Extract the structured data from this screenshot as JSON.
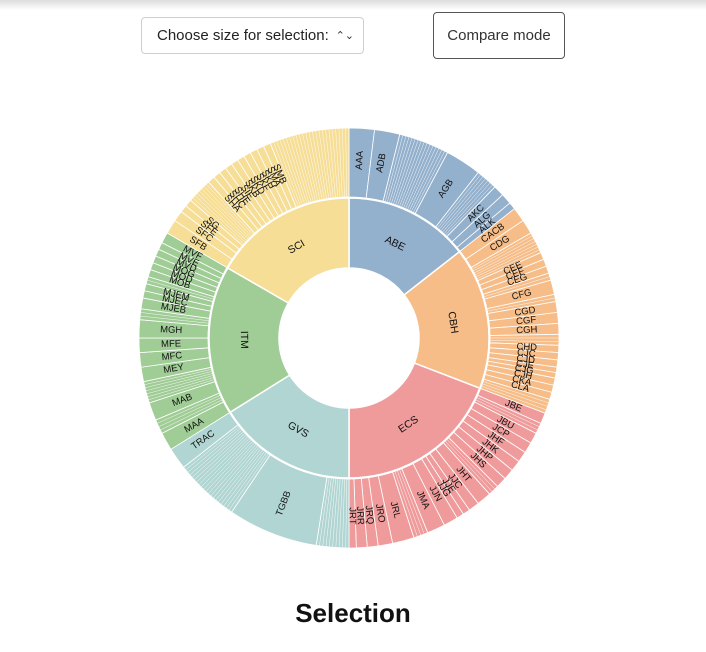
{
  "controls": {
    "size_select_label": "Choose size for selection:",
    "compare_label": "Compare mode"
  },
  "section_title": "Selection",
  "chart_data": {
    "type": "sunburst",
    "center_empty": true,
    "groups": [
      {
        "name": "ABE",
        "color": "#93b0cc",
        "start": 0,
        "end": 52,
        "children": [
          {
            "name": "AAA",
            "s": 0,
            "e": 7,
            "label": true
          },
          {
            "name": "ADB",
            "s": 7,
            "e": 14,
            "label": true
          },
          {
            "name": "",
            "s": 14,
            "e": 28,
            "label": false,
            "fine": true
          },
          {
            "name": "AGB",
            "s": 28,
            "e": 38,
            "label": true
          },
          {
            "name": "",
            "s": 38,
            "e": 44,
            "label": false,
            "fine": true
          },
          {
            "name": "AKC",
            "s": 44,
            "e": 47,
            "label": true
          },
          {
            "name": "ALG",
            "s": 47,
            "e": 50,
            "label": true
          },
          {
            "name": "ALK",
            "s": 50,
            "e": 52,
            "label": true
          }
        ]
      },
      {
        "name": "CBH",
        "color": "#f6bd88",
        "start": 52,
        "end": 111,
        "children": [
          {
            "name": "CACB",
            "s": 52,
            "e": 56,
            "label": true
          },
          {
            "name": "CDG",
            "s": 56,
            "e": 60,
            "label": true
          },
          {
            "name": "",
            "s": 60,
            "e": 66,
            "label": false,
            "fine": true
          },
          {
            "name": "CEE",
            "s": 66,
            "e": 68,
            "label": true
          },
          {
            "name": "CEF",
            "s": 68,
            "e": 70,
            "label": true
          },
          {
            "name": "CEG",
            "s": 70,
            "e": 72,
            "label": true
          },
          {
            "name": "",
            "s": 72,
            "e": 74,
            "label": false,
            "fine": true
          },
          {
            "name": "CFG",
            "s": 74,
            "e": 78,
            "label": true
          },
          {
            "name": "",
            "s": 78,
            "e": 80,
            "label": false,
            "fine": true
          },
          {
            "name": "CGD",
            "s": 80,
            "e": 83,
            "label": true
          },
          {
            "name": "CGF",
            "s": 83,
            "e": 86,
            "label": true
          },
          {
            "name": "CGH",
            "s": 86,
            "e": 89,
            "label": true
          },
          {
            "name": "",
            "s": 89,
            "e": 92,
            "label": false,
            "fine": true
          },
          {
            "name": "CHD",
            "s": 92,
            "e": 94,
            "label": true
          },
          {
            "name": "CJC",
            "s": 94,
            "e": 96,
            "label": true
          },
          {
            "name": "CJD",
            "s": 96,
            "e": 98,
            "label": true
          },
          {
            "name": "CJE",
            "s": 98,
            "e": 99.5,
            "label": true
          },
          {
            "name": "CJG",
            "s": 99.5,
            "e": 101,
            "label": true
          },
          {
            "name": "CJH",
            "s": 101,
            "e": 103,
            "label": true
          },
          {
            "name": "CKA",
            "s": 103,
            "e": 105,
            "label": true
          },
          {
            "name": "CLA",
            "s": 105,
            "e": 107,
            "label": true
          },
          {
            "name": "",
            "s": 107,
            "e": 111,
            "label": false,
            "fine": true
          }
        ]
      },
      {
        "name": "ECS",
        "color": "#f09b9b",
        "start": 111,
        "end": 180,
        "children": [
          {
            "name": "JBE",
            "s": 111,
            "e": 114,
            "label": true
          },
          {
            "name": "",
            "s": 114,
            "e": 117,
            "label": false,
            "fine": true
          },
          {
            "name": "JBU",
            "s": 117,
            "e": 120,
            "label": true
          },
          {
            "name": "JCP",
            "s": 120,
            "e": 123,
            "label": true
          },
          {
            "name": "JHF",
            "s": 123,
            "e": 126,
            "label": true
          },
          {
            "name": "JHK",
            "s": 126,
            "e": 129,
            "label": true
          },
          {
            "name": "JHP",
            "s": 129,
            "e": 132,
            "label": true
          },
          {
            "name": "JHS",
            "s": 132,
            "e": 135,
            "label": true
          },
          {
            "name": "",
            "s": 135,
            "e": 138,
            "label": false,
            "fine": true
          },
          {
            "name": "JHT",
            "s": 138,
            "e": 142,
            "label": true
          },
          {
            "name": "JJC",
            "s": 142,
            "e": 145,
            "label": true
          },
          {
            "name": "JJE",
            "s": 145,
            "e": 147,
            "label": true
          },
          {
            "name": "JJG",
            "s": 147,
            "e": 149,
            "label": true
          },
          {
            "name": "JJN",
            "s": 149,
            "e": 153,
            "label": true
          },
          {
            "name": "JMA",
            "s": 153,
            "e": 158,
            "label": true
          },
          {
            "name": "",
            "s": 158,
            "e": 162,
            "label": false,
            "fine": true
          },
          {
            "name": "JRL",
            "s": 162,
            "e": 168,
            "label": true
          },
          {
            "name": "JRO",
            "s": 168,
            "e": 172,
            "label": true
          },
          {
            "name": "JRQ",
            "s": 172,
            "e": 175,
            "label": true
          },
          {
            "name": "JRR",
            "s": 175,
            "e": 178,
            "label": true
          },
          {
            "name": "JRT",
            "s": 178,
            "e": 180,
            "label": true
          }
        ]
      },
      {
        "name": "GVS",
        "color": "#b1d5d2",
        "start": 180,
        "end": 238,
        "children": [
          {
            "name": "",
            "s": 180,
            "e": 189,
            "label": false,
            "fine": true
          },
          {
            "name": "TGBB",
            "s": 189,
            "e": 214,
            "label": true
          },
          {
            "name": "",
            "s": 214,
            "e": 232,
            "label": false,
            "fine": true
          },
          {
            "name": "TRAC",
            "s": 232,
            "e": 238,
            "label": true
          }
        ]
      },
      {
        "name": "ITM",
        "color": "#a0cc96",
        "start": 238,
        "end": 300,
        "children": [
          {
            "name": "MAA",
            "s": 238,
            "e": 243,
            "label": true
          },
          {
            "name": "",
            "s": 243,
            "e": 247,
            "label": false,
            "fine": true
          },
          {
            "name": "MAB",
            "s": 247,
            "e": 252,
            "label": true
          },
          {
            "name": "",
            "s": 252,
            "e": 258,
            "label": false,
            "fine": true
          },
          {
            "name": "MEY",
            "s": 258,
            "e": 262,
            "label": true
          },
          {
            "name": "MFC",
            "s": 262,
            "e": 266,
            "label": true
          },
          {
            "name": "MFE",
            "s": 266,
            "e": 270,
            "label": true
          },
          {
            "name": "MGH",
            "s": 270,
            "e": 275,
            "label": true
          },
          {
            "name": "",
            "s": 275,
            "e": 278,
            "label": false,
            "fine": true
          },
          {
            "name": "MJEB",
            "s": 278,
            "e": 281,
            "label": true
          },
          {
            "name": "MJEC",
            "s": 281,
            "e": 283,
            "label": true
          },
          {
            "name": "MJEM",
            "s": 283,
            "e": 285,
            "label": true
          },
          {
            "name": "",
            "s": 285,
            "e": 287,
            "label": false,
            "fine": true
          },
          {
            "name": "MOB",
            "s": 287,
            "e": 289,
            "label": true
          },
          {
            "name": "MOD",
            "s": 289,
            "e": 291,
            "label": true
          },
          {
            "name": "MOG",
            "s": 291,
            "e": 293,
            "label": true
          },
          {
            "name": "MVD",
            "s": 293,
            "e": 295,
            "label": true
          },
          {
            "name": "MVE",
            "s": 295,
            "e": 297,
            "label": true
          },
          {
            "name": "MVF",
            "s": 297,
            "e": 300,
            "label": true
          }
        ]
      },
      {
        "name": "SCI",
        "color": "#f6de96",
        "start": 300,
        "end": 360,
        "children": [
          {
            "name": "SFB",
            "s": 300,
            "e": 304,
            "label": true
          },
          {
            "name": "SFC",
            "s": 304,
            "e": 307,
            "label": true
          },
          {
            "name": "SFE",
            "s": 307,
            "e": 309,
            "label": true
          },
          {
            "name": "SG",
            "s": 309,
            "e": 311,
            "label": true
          },
          {
            "name": "",
            "s": 311,
            "e": 318,
            "label": false,
            "fine": true
          },
          {
            "name": "SHA",
            "s": 318,
            "e": 320,
            "label": true
          },
          {
            "name": "SHC",
            "s": 320,
            "e": 322,
            "label": true
          },
          {
            "name": "SHE",
            "s": 322,
            "e": 324,
            "label": true
          },
          {
            "name": "SIE",
            "s": 324,
            "e": 326,
            "label": true
          },
          {
            "name": "SKB",
            "s": 326,
            "e": 328,
            "label": true
          },
          {
            "name": "SKD",
            "s": 328,
            "e": 330,
            "label": true
          },
          {
            "name": "SKF",
            "s": 330,
            "e": 332,
            "label": true
          },
          {
            "name": "SKH",
            "s": 332,
            "e": 334,
            "label": true
          },
          {
            "name": "SMA",
            "s": 334,
            "e": 336,
            "label": true
          },
          {
            "name": "SMB",
            "s": 336,
            "e": 338,
            "label": true
          },
          {
            "name": "",
            "s": 338,
            "e": 360,
            "label": false,
            "fine": true
          }
        ]
      }
    ]
  }
}
